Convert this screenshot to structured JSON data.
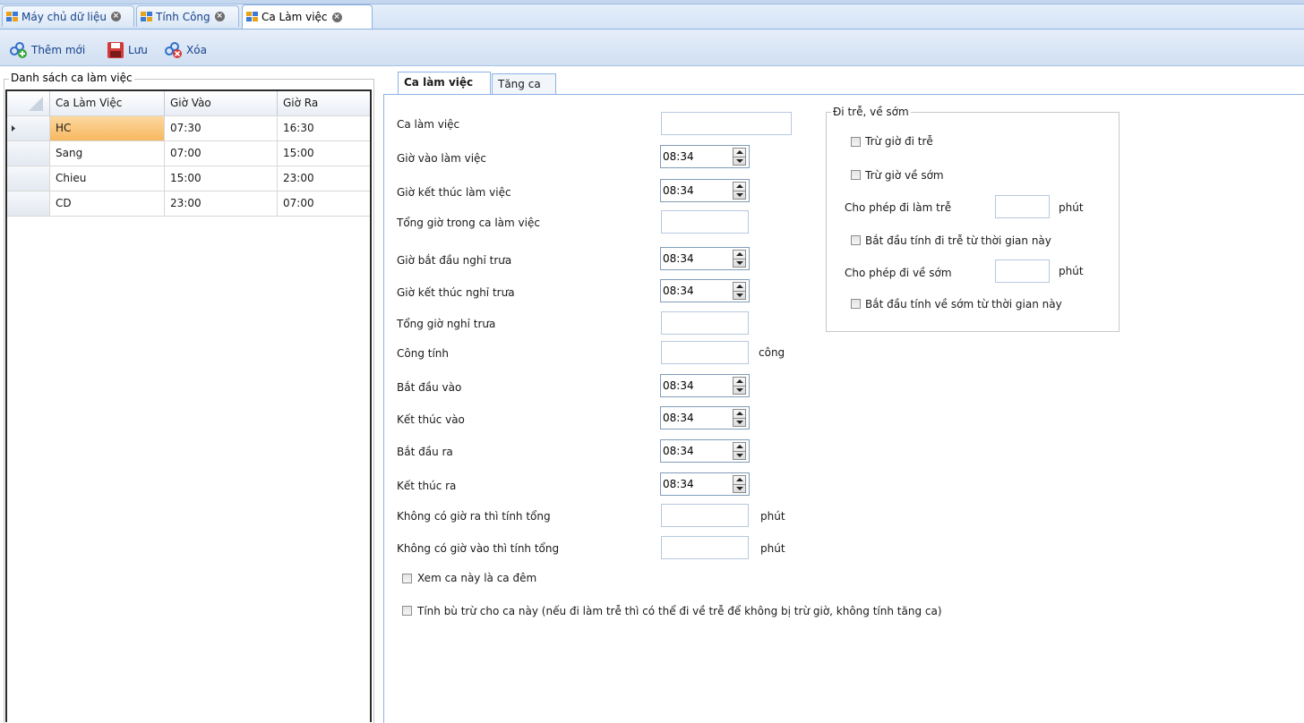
{
  "doc_tabs": [
    {
      "label": "Máy chủ dữ liệu"
    },
    {
      "label": "Tính Công"
    },
    {
      "label": "Ca Làm việc"
    }
  ],
  "toolbar": {
    "add_label": "Thêm mới",
    "save_label": "Lưu",
    "delete_label": "Xóa"
  },
  "list_panel": {
    "title": "Danh sách ca làm việc",
    "columns": [
      "Ca Làm Việc",
      "Giờ Vào",
      "Giờ Ra"
    ],
    "rows": [
      {
        "name": "HC",
        "in": "07:30",
        "out": "16:30",
        "selected": true
      },
      {
        "name": "Sang",
        "in": "07:00",
        "out": "15:00"
      },
      {
        "name": "Chieu",
        "in": "15:00",
        "out": "23:00"
      },
      {
        "name": "CD",
        "in": "23:00",
        "out": "07:00"
      }
    ]
  },
  "detail_tabs": [
    "Ca làm việc",
    "Tăng ca"
  ],
  "form": {
    "shift_name": {
      "label": "Ca làm việc",
      "value": ""
    },
    "start_time": {
      "label": "Giờ vào làm việc",
      "value": "08:34"
    },
    "end_time": {
      "label": "Giờ kết thúc làm việc",
      "value": "08:34"
    },
    "total_hours": {
      "label": "Tổng giờ trong ca làm việc",
      "value": ""
    },
    "lunch_start": {
      "label": "Giờ bắt đầu nghỉ trưa",
      "value": "08:34"
    },
    "lunch_end": {
      "label": "Giờ kết thúc nghỉ trưa",
      "value": "08:34"
    },
    "lunch_total": {
      "label": "Tổng giờ nghỉ trưa",
      "value": ""
    },
    "work_credit": {
      "label": "Công tính",
      "value": "",
      "unit": "công"
    },
    "checkin_start": {
      "label": "Bắt đầu vào",
      "value": "08:34"
    },
    "checkin_end": {
      "label": "Kết thúc vào",
      "value": "08:34"
    },
    "checkout_start": {
      "label": "Bắt đầu ra",
      "value": "08:34"
    },
    "checkout_end": {
      "label": "Kết thúc ra",
      "value": "08:34"
    },
    "no_checkout": {
      "label": "Không có giờ ra thì tính tổng",
      "value": "",
      "unit": "phút"
    },
    "no_checkin": {
      "label": "Không có giờ vào thì tính tổng",
      "value": "",
      "unit": "phút"
    },
    "night_shift": {
      "label": "Xem ca này là ca đêm",
      "checked": false
    },
    "compensate": {
      "label": "Tính bù trừ cho ca này (nếu đi làm trễ thì có thể đi về trễ để không bị trừ giờ, không tính tăng ca)",
      "checked": false
    }
  },
  "late_early": {
    "title": "Đi trễ, về sớm",
    "deduct_late": {
      "label": "Trừ giờ đi trễ",
      "checked": false
    },
    "deduct_early": {
      "label": "Trừ giờ về sớm",
      "checked": false
    },
    "allow_late": {
      "label": "Cho phép đi làm trễ",
      "value": "",
      "unit": "phút"
    },
    "late_from": {
      "label": "Bắt đầu tính đi trễ từ thời gian này",
      "checked": false
    },
    "allow_early": {
      "label": "Cho phép đi về sớm",
      "value": "",
      "unit": "phút"
    },
    "early_from": {
      "label": "Bắt đầu tính về sớm từ thời gian này",
      "checked": false
    }
  },
  "colors": {
    "accent": "#15428b",
    "selected_row": "#f9c57a"
  }
}
